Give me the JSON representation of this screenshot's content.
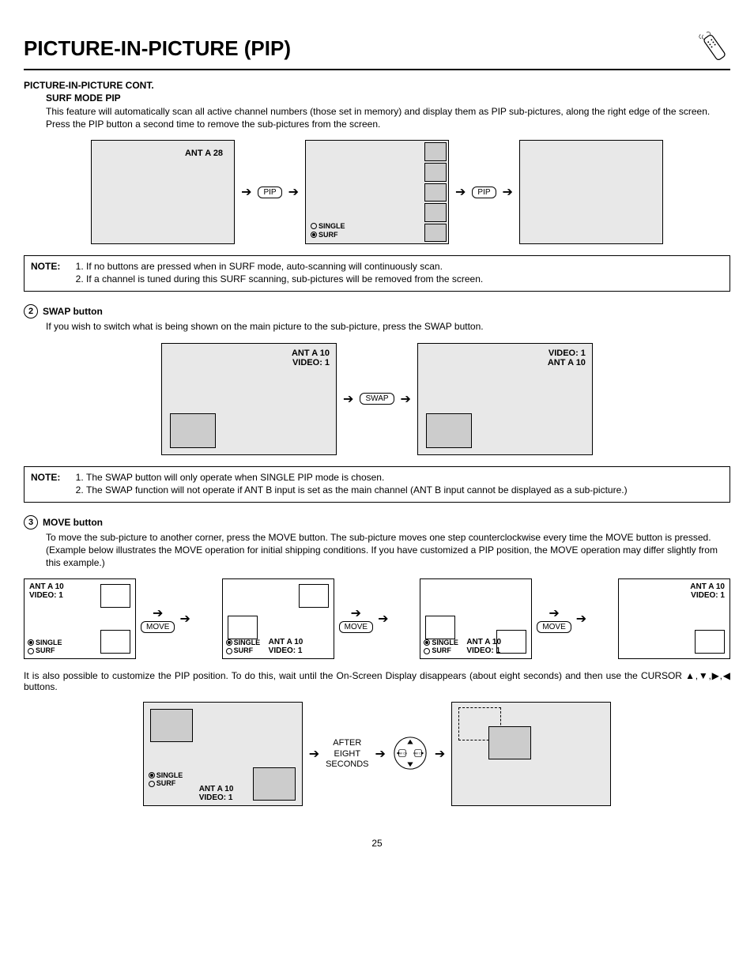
{
  "page": {
    "title": "PICTURE-IN-PICTURE (PIP)",
    "number": "25"
  },
  "section_cont": "PICTURE-IN-PICTURE CONT.",
  "surf": {
    "heading": "SURF MODE PIP",
    "body": "This feature will automatically scan all active channel numbers (those set in memory) and display them as PIP sub-pictures, along the right edge of the screen.  Press the PIP button a second time to remove the sub-pictures from the screen."
  },
  "labels": {
    "ant_a_28": "ANT A   28",
    "pip": "PIP",
    "single": "SINGLE",
    "surf": "SURF",
    "swap_btn": "SWAP",
    "move_btn": "MOVE",
    "ant_a_10": "ANT A 10",
    "video_1": "VIDEO: 1",
    "video_1_short": "VIDEO: 1",
    "ant_a_10_sp": "ANT  A 10",
    "after": "AFTER EIGHT SECONDS"
  },
  "notes": {
    "label": "NOTE:",
    "surf": [
      "If no buttons are pressed when in SURF mode, auto-scanning will continuously scan.",
      "If a channel is tuned during this SURF scanning, sub-pictures will be removed from the screen."
    ],
    "swap": [
      "The SWAP button will only operate when SINGLE PIP mode is chosen.",
      "The SWAP function will not operate if ANT B input is set as the main channel (ANT B input cannot be displayed as a sub-picture.)"
    ]
  },
  "swap": {
    "num": "2",
    "heading": "SWAP button",
    "body": "If you wish to switch what is being shown on the main picture to the sub-picture, press the SWAP button."
  },
  "move": {
    "num": "3",
    "heading": "MOVE button",
    "body": "To move the sub-picture to another corner, press the MOVE button.  The sub-picture moves one step counterclockwise every time the MOVE button is pressed.  (Example below illustrates the MOVE operation for initial shipping conditions.  If you have customized a PIP position, the MOVE operation may differ slightly from this example.)",
    "tail": "It is also possible to customize the PIP position.  To do this, wait until the On-Screen Display disappears (about eight seconds) and then use the CURSOR ▲,▼,▶,◀ buttons."
  }
}
